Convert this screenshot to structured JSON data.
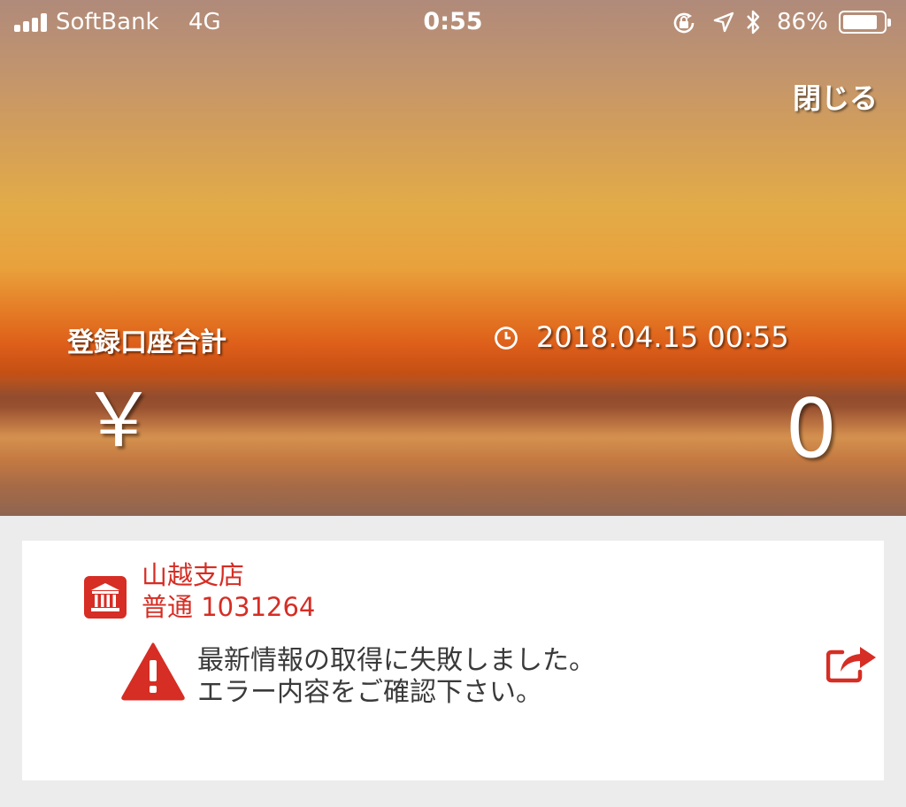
{
  "statusbar": {
    "carrier": "SoftBank",
    "network": "4G",
    "time": "0:55",
    "battery": "86%",
    "battery_level": 0.86,
    "icons": [
      "orientation-lock-icon",
      "location-arrow-icon",
      "bluetooth-icon"
    ]
  },
  "header": {
    "close_label": "閉じる"
  },
  "summary": {
    "label": "登録口座合計",
    "updated_at": "2018.04.15 00:55",
    "currency_symbol": "￥",
    "amount": "0"
  },
  "account_card": {
    "branch": "山越支店",
    "account": "普通 1031264",
    "error_lines": [
      "最新情報の取得に失敗しました。",
      "エラー内容をご確認下さい。"
    ]
  },
  "colors": {
    "accent_red": "#d62d24",
    "text_dark": "#3a3a3a",
    "background": "#ececec"
  }
}
